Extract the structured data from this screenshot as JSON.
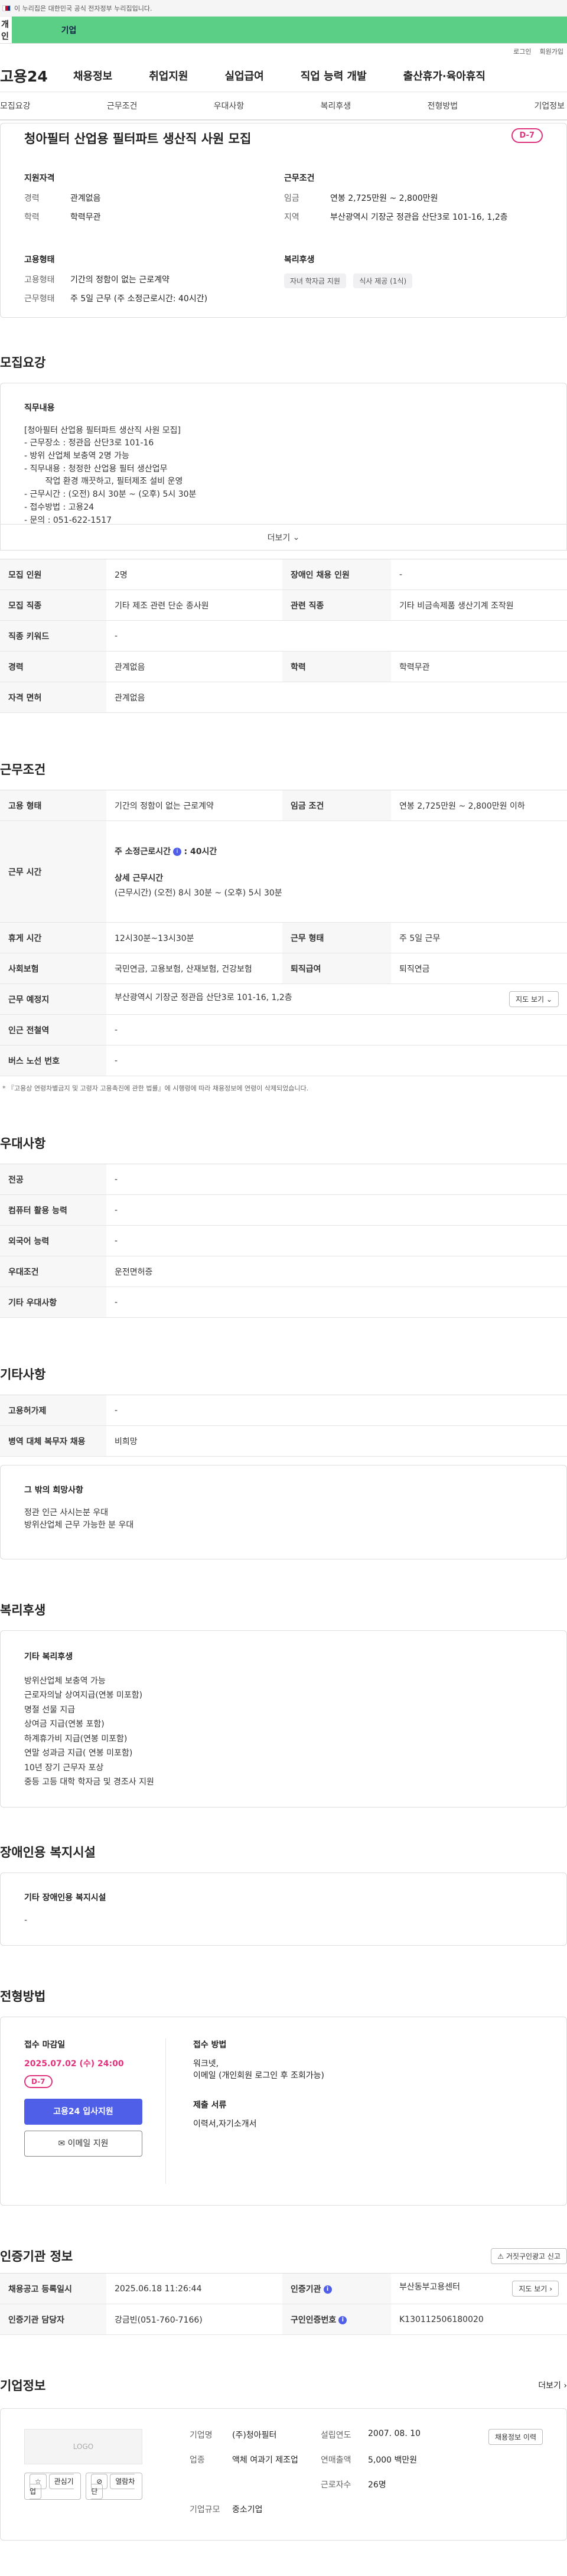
{
  "gov_strip": "이 누리집은 대한민국 공식 전자정부 누리집입니다.",
  "user_tabs": {
    "personal": "개인",
    "company": "기업"
  },
  "util_links": [
    "로그인",
    "회원가입"
  ],
  "logo": "고용24",
  "gnb": [
    "채용정보",
    "취업지원",
    "실업급여",
    "직업 능력 개발",
    "출산휴가·육아휴직"
  ],
  "anchor_nav": [
    "모집요강",
    "근무조건",
    "우대사항",
    "복리후생",
    "전형방법",
    "기업정보"
  ],
  "summary": {
    "title": "청아필터 산업용 필터파트 생산직 사원 모집",
    "dday": "D-7",
    "qualification": {
      "heading": "지원자격",
      "rows": [
        {
          "k": "경력",
          "v": "관계없음"
        },
        {
          "k": "학력",
          "v": "학력무관"
        }
      ]
    },
    "employment": {
      "heading": "고용형태",
      "rows": [
        {
          "k": "고용형태",
          "v": "기간의 정함이 없는 근로계약"
        },
        {
          "k": "근무형태",
          "v": "주 5일 근무 (주 소정근로시간: 40시간)"
        }
      ]
    },
    "conditions": {
      "heading": "근무조건",
      "rows": [
        {
          "k": "임금",
          "v": "연봉 2,725만원 ~ 2,800만원"
        },
        {
          "k": "지역",
          "v": "부산광역시 기장군 정관읍 산단3로 101-16, 1,2층"
        }
      ]
    },
    "welfare": {
      "heading": "복리후생",
      "tags": [
        "자녀 학자금 지원",
        "식사 제공 (1식)"
      ]
    }
  },
  "recruit": {
    "heading": "모집요강",
    "box_title": "직무내용",
    "lines": [
      "[청아필터 산업용 필터파트 생산직 사원 모집]",
      "- 근무장소 : 정관읍 산단3로 101-16",
      "- 방위 산업체 보충역 2명 가능",
      "- 직무내용 : 청정한 산업용 필터 생산업무",
      "        작업 환경 깨끗하고, 필터제조 설비 운영",
      "- 근무시간 : (오전) 8시 30분 ~ (오후) 5시 30분",
      "- 접수방법 : 고용24",
      "- 문의 : 051-622-1517"
    ],
    "more": "더보기",
    "table": [
      [
        "모집 인원",
        "2명",
        "장애인 채용 인원",
        "-"
      ],
      [
        "모집 직종",
        "기타 제조 관련 단순 종사원",
        "관련 직종",
        "기타 비금속제품 생산기계 조작원"
      ],
      [
        "직종 키워드",
        "-"
      ],
      [
        "경력",
        "관계없음",
        "학력",
        "학력무관"
      ],
      [
        "자격 면허",
        "관계없음"
      ]
    ]
  },
  "work": {
    "heading": "근무조건",
    "emp_type_label": "고용 형태",
    "emp_type": "기간의 정함이 없는 근로계약",
    "wage_label": "임금 조건",
    "wage": "연봉 2,725만원 ~ 2,800만원 이하",
    "hours_label": "근무 시간",
    "hours_weekly": "주 소정근로시간",
    "hours_weekly_value": ": 40시간",
    "hours_detail_title": "상세 근무시간",
    "hours_detail": "(근무시간) (오전) 8시 30분 ~ (오후) 5시 30분",
    "rows": [
      [
        "휴게 시간",
        "12시30분~13시30분",
        "근무 형태",
        "주 5일 근무"
      ],
      [
        "사회보험",
        "국민연금, 고용보험, 산재보험, 건강보험",
        "퇴직급여",
        "퇴직연금"
      ]
    ],
    "location_label": "근무 예정지",
    "location": "부산광역시 기장군 정관읍 산단3로 101-16, 1,2층",
    "map_btn": "지도 보기",
    "station_label": "인근 전철역",
    "station": "-",
    "bus_label": "버스 노선 번호",
    "bus": "-",
    "note": "* 『고용상 연령차별금지 및 고령자 고용촉진에 관한 법률』에 시행령에 따라 채용정보에 연령이 삭제되었습니다."
  },
  "pref": {
    "heading": "우대사항",
    "rows": [
      [
        "전공",
        "-"
      ],
      [
        "컴퓨터 활용 능력",
        "-"
      ],
      [
        "외국어 능력",
        "-"
      ],
      [
        "우대조건",
        "운전면허증"
      ],
      [
        "기타 우대사항",
        "-"
      ]
    ]
  },
  "etc": {
    "heading": "기타사항",
    "rows": [
      [
        "고용허가제",
        "-"
      ],
      [
        "병역 대체 복무자 채용",
        "비희망"
      ]
    ],
    "box_title": "그 밖의 희망사항",
    "lines": [
      "정관 인근 사시는분 우대",
      "방위산업체 근무 가능한 분 우대"
    ]
  },
  "welfare": {
    "heading": "복리후생",
    "box_title": "기타 복리후생",
    "lines": [
      "방위산업체 보충역 가능",
      "근로자의날 상여지급(연봉 미포함)",
      "명절 선물 지급",
      "상여금 지급(연봉 포함)",
      "하계휴가비 지급(연봉 미포함)",
      "연말 성과금 지급( 연봉 미포함)",
      "10년 장기 근무자 포상",
      "중등 고등 대학 학자금 및 경조사 지원"
    ]
  },
  "disabled": {
    "heading": "장애인용 복지시설",
    "box_title": "기타 장애인용 복지시설",
    "value": "-"
  },
  "apply": {
    "heading": "전형방법",
    "deadline_title": "접수 마감일",
    "deadline": "2025.07.02 (수) 24:00",
    "dday": "D-7",
    "btn_primary": "고용24 입사지원",
    "btn_email": "이메일 지원",
    "method_title": "접수 방법",
    "method_lines": [
      "워크넷,",
      "이메일 (개인회원 로그인 후 조회가능)"
    ],
    "docs_title": "제출 서류",
    "docs": "이력서,자기소개서"
  },
  "agency": {
    "heading": "인증기관 정보",
    "report_btn": "거짓구인광고 신고",
    "rows": [
      [
        "채용공고 등록일시",
        "2025.06.18 11:26:44",
        "인증기관",
        "부산동부고용센터"
      ],
      [
        "인증기관 담당자",
        "강금빈(051-760-7166)",
        "구인인증번호",
        "K130112506180020"
      ]
    ],
    "map_btn": "지도 보기"
  },
  "company": {
    "heading": "기업정보",
    "more": "더보기",
    "logo_ph": "LOGO",
    "btn_interest": "관심기업",
    "btn_block": "열람차단",
    "info": [
      [
        "기업명",
        "(주)청아필터",
        "설립연도",
        "2007. 08. 10"
      ],
      [
        "업종",
        "액체 여과기 제조업",
        "연매출액",
        "5,000 백만원"
      ],
      [
        "",
        "",
        "근로자수",
        "26명"
      ],
      [
        "기업규모",
        "중소기업",
        "",
        ""
      ]
    ],
    "btn_jobs": "채용정보 이력"
  },
  "colors": {
    "accent": "#4f5fe8",
    "dday": "#e0337d",
    "company_tab": "#5ccf86"
  }
}
